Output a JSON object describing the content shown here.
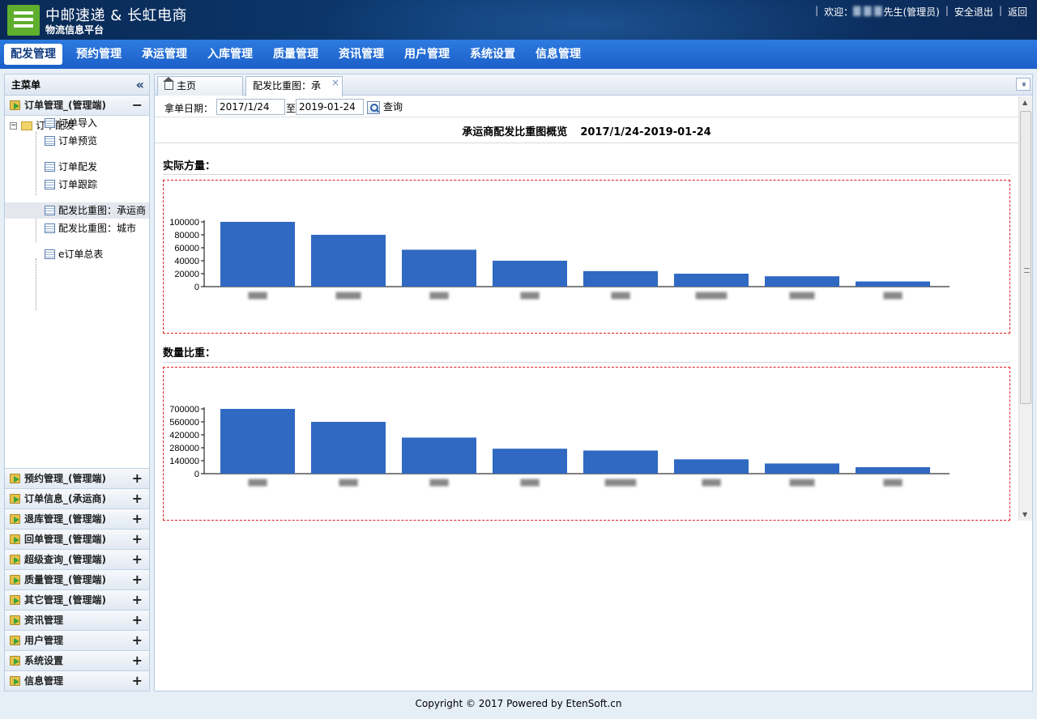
{
  "header": {
    "brand_title": "中邮速递 & 长虹电商",
    "brand_sub": "物流信息平台",
    "welcome": "欢迎：",
    "user_masked": "▇ ▇ ▇",
    "user_role": "先生(管理员)",
    "logout": "安全退出",
    "back": "返回"
  },
  "nav": {
    "items": [
      "配发管理",
      "预约管理",
      "承运管理",
      "入库管理",
      "质量管理",
      "资讯管理",
      "用户管理",
      "系统设置",
      "信息管理"
    ],
    "active_index": 0
  },
  "sidebar": {
    "title": "主菜单",
    "open_section": "订单管理_(管理端)",
    "tree_root": "订单配发",
    "tree_items": [
      "订单导入",
      "订单预览",
      "订单配发",
      "订单跟踪",
      "配发比重图：承运商",
      "配发比重图：城市",
      "e订单总表"
    ],
    "selected_item_index": 4,
    "collapsed_sections": [
      "预约管理_(管理端)",
      "订单信息_(承运商)",
      "退库管理_(管理端)",
      "回单管理_(管理端)",
      "超级查询_(管理端)",
      "质量管理_(管理端)",
      "其它管理_(管理端)",
      "资讯管理",
      "用户管理",
      "系统设置",
      "信息管理"
    ]
  },
  "tabs": {
    "home": "主页",
    "current": "配发比重图：承",
    "close_glyph": "×",
    "menu_glyph": "»"
  },
  "toolbar": {
    "label": "拿单日期：",
    "from_date": "2017/1/24",
    "to_label": "至",
    "to_date": "2019-01-24",
    "query_label": "查询"
  },
  "report": {
    "title": "承运商配发比重图概览",
    "range": "2017/1/24-2019-01-24",
    "section1_label": "实际方量：",
    "section2_label": "数量比重："
  },
  "chart_data": [
    {
      "type": "bar",
      "title": "",
      "categories": [
        "▆▆▆",
        "▆▆▆▆",
        "▆▆▆",
        "▆▆▆",
        "▆▆▆",
        "▆▆▆▆▆",
        "▆▆▆▆",
        "▆▆▆"
      ],
      "values": [
        100000,
        80000,
        57000,
        40000,
        24000,
        20000,
        16000,
        8000
      ],
      "yticks": [
        "0",
        "20000",
        "40000",
        "60000",
        "80000",
        "100000"
      ],
      "ylim": [
        0,
        100000
      ],
      "bar_color": "#3069c2",
      "xlabel": "",
      "ylabel": ""
    },
    {
      "type": "bar",
      "title": "",
      "categories": [
        "▆▆▆",
        "▆▆▆",
        "▆▆▆",
        "▆▆▆",
        "▆▆▆▆▆",
        "▆▆▆",
        "▆▆▆▆",
        "▆▆▆"
      ],
      "values": [
        700000,
        560000,
        390000,
        270000,
        250000,
        155000,
        110000,
        70000
      ],
      "yticks": [
        "0",
        "140000",
        "280000",
        "420000",
        "560000",
        "700000"
      ],
      "ylim": [
        0,
        700000
      ],
      "bar_color": "#3069c2",
      "xlabel": "",
      "ylabel": ""
    }
  ],
  "footer": {
    "text": "Copyright © 2017 Powered by EtenSoft.cn"
  }
}
